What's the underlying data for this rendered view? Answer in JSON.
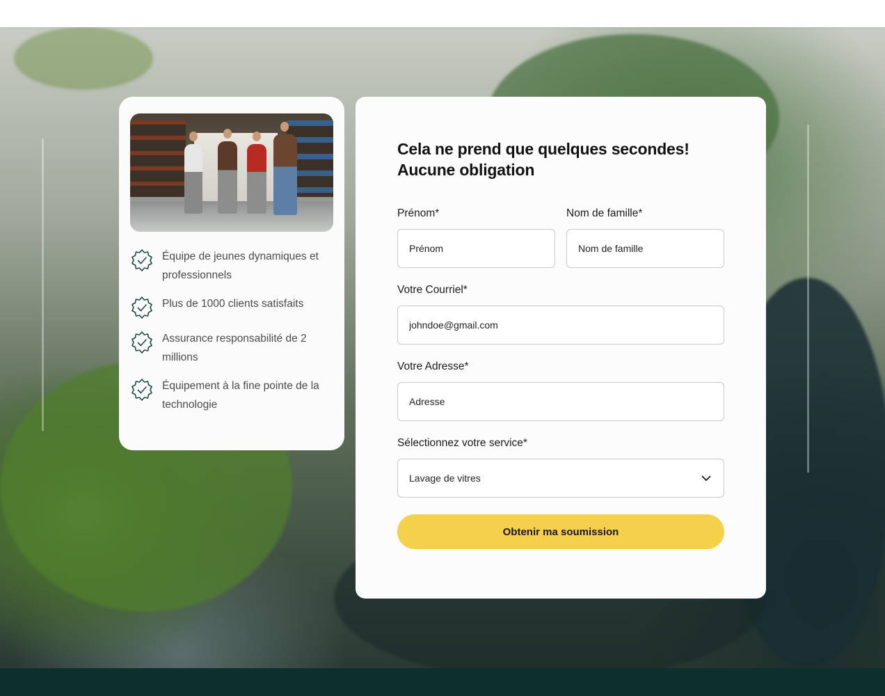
{
  "form": {
    "title_line1": "Cela ne prend que quelques secondes!",
    "title_line2": "Aucune obligation",
    "first_name": {
      "label": "Prénom*",
      "placeholder": "Prénom"
    },
    "last_name": {
      "label": "Nom de famille*",
      "placeholder": "Nom de famille"
    },
    "email": {
      "label": "Votre Courriel*",
      "placeholder": "johndoe@gmail.com"
    },
    "address": {
      "label": "Votre Adresse*",
      "placeholder": "Adresse"
    },
    "service": {
      "label": "Sélectionnez votre service*",
      "selected": "Lavage de vitres"
    },
    "submit_label": "Obtenir ma soumission"
  },
  "features": [
    {
      "text": "Équipe de jeunes dynamiques et professionnels",
      "icon": "verified-badge-icon"
    },
    {
      "text": "Plus de 1000 clients satisfaits",
      "icon": "verified-badge-icon"
    },
    {
      "text": "Assurance responsabilité de 2 millions",
      "icon": "verified-badge-icon"
    },
    {
      "text": "Équipement à la fine pointe de la technologie",
      "icon": "verified-badge-icon"
    }
  ],
  "colors": {
    "accent": "#f4d04b",
    "footer": "#0c302b",
    "icon_stroke": "#1f4a44"
  }
}
